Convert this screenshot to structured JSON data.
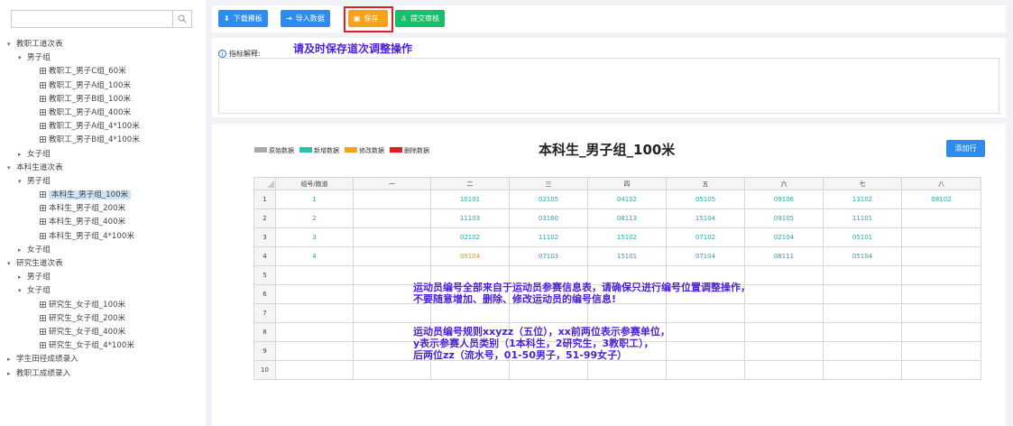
{
  "search": {
    "placeholder": "",
    "icon": "search-icon"
  },
  "tree": [
    {
      "label": "教职工道次表",
      "level": 0,
      "state": "open"
    },
    {
      "label": "男子组",
      "level": 1,
      "state": "open"
    },
    {
      "label": "教职工_男子C组_60米",
      "level": 2,
      "state": "leaf"
    },
    {
      "label": "教职工_男子A组_100米",
      "level": 2,
      "state": "leaf"
    },
    {
      "label": "教职工_男子B组_100米",
      "level": 2,
      "state": "leaf"
    },
    {
      "label": "教职工_男子A组_400米",
      "level": 2,
      "state": "leaf"
    },
    {
      "label": "教职工_男子A组_4*100米",
      "level": 2,
      "state": "leaf"
    },
    {
      "label": "教职工_男子B组_4*100米",
      "level": 2,
      "state": "leaf"
    },
    {
      "label": "女子组",
      "level": 1,
      "state": "closed"
    },
    {
      "label": "本科生道次表",
      "level": 0,
      "state": "open"
    },
    {
      "label": "男子组",
      "level": 1,
      "state": "open"
    },
    {
      "label": "本科生_男子组_100米",
      "level": 2,
      "state": "leaf",
      "selected": true
    },
    {
      "label": "本科生_男子组_200米",
      "level": 2,
      "state": "leaf"
    },
    {
      "label": "本科生_男子组_400米",
      "level": 2,
      "state": "leaf"
    },
    {
      "label": "本科生_男子组_4*100米",
      "level": 2,
      "state": "leaf"
    },
    {
      "label": "女子组",
      "level": 1,
      "state": "closed"
    },
    {
      "label": "研究生道次表",
      "level": 0,
      "state": "open"
    },
    {
      "label": "男子组",
      "level": 1,
      "state": "closed"
    },
    {
      "label": "女子组",
      "level": 1,
      "state": "open"
    },
    {
      "label": "研究生_女子组_100米",
      "level": 2,
      "state": "leaf"
    },
    {
      "label": "研究生_女子组_200米",
      "level": 2,
      "state": "leaf"
    },
    {
      "label": "研究生_女子组_400米",
      "level": 2,
      "state": "leaf"
    },
    {
      "label": "研究生_女子组_4*100米",
      "level": 2,
      "state": "leaf"
    },
    {
      "label": "学生田径成绩录入",
      "level": 0,
      "state": "closed"
    },
    {
      "label": "教职工成绩录入",
      "level": 0,
      "state": "closed"
    }
  ],
  "toolbar": {
    "download_label": "下载模板",
    "import_label": "导入数据",
    "save_label": "保存",
    "submit_label": "提交审核",
    "colors": {
      "download": "#2d8cf0",
      "import": "#2d8cf0",
      "save": "#f7a21b",
      "submit": "#19be6b"
    }
  },
  "annotations": {
    "save_hint": "请及时保存道次调整操作",
    "id_hint_1": "运动员编号全部来自于运动员参赛信息表，请确保只进行编号位置调整操作，",
    "id_hint_2": "不要随意增加、删除、修改运动员的编号信息!",
    "rule_1": "运动员编号规则xxyzz（五位），xx前两位表示参赛单位，",
    "rule_2": "y表示参赛人员类别（1本科生，2研究生，3教职工），",
    "rule_3": "后两位zz（流水号，01-50男子，51-99女子）"
  },
  "indicator": {
    "label": "指标解释:"
  },
  "legend": [
    {
      "label": "原始数据",
      "color": "#aaaaaa"
    },
    {
      "label": "新增数据",
      "color": "#2bbfb3"
    },
    {
      "label": "修改数据",
      "color": "#f7a21b"
    },
    {
      "label": "删除数据",
      "color": "#e02020"
    }
  ],
  "title": "本科生_男子组_100米",
  "add_row_label": "添加行",
  "table": {
    "headers": [
      "组号/跑道",
      "一",
      "二",
      "三",
      "四",
      "五",
      "六",
      "七",
      "八"
    ],
    "rows": [
      {
        "n": "1",
        "cells": [
          "1",
          "",
          "10101",
          "02105",
          "04102",
          "05105",
          "09106",
          "13102",
          "08102"
        ]
      },
      {
        "n": "2",
        "cells": [
          "2",
          "",
          "11103",
          "03160",
          "08113",
          "15104",
          "09105",
          "11101",
          ""
        ]
      },
      {
        "n": "3",
        "cells": [
          "3",
          "",
          "02102",
          "11102",
          "15102",
          "07102",
          "02104",
          "05101",
          ""
        ]
      },
      {
        "n": "4",
        "cells": [
          "4",
          "",
          "09104",
          "07103",
          "15101",
          "07104",
          "08111",
          "05104",
          ""
        ]
      },
      {
        "n": "5",
        "cells": [
          "",
          "",
          "",
          "",
          "",
          "",
          "",
          "",
          ""
        ]
      },
      {
        "n": "6",
        "cells": [
          "",
          "",
          "",
          "",
          "",
          "",
          "",
          "",
          ""
        ]
      },
      {
        "n": "7",
        "cells": [
          "",
          "",
          "",
          "",
          "",
          "",
          "",
          "",
          ""
        ]
      },
      {
        "n": "8",
        "cells": [
          "",
          "",
          "",
          "",
          "",
          "",
          "",
          "",
          ""
        ]
      },
      {
        "n": "9",
        "cells": [
          "",
          "",
          "",
          "",
          "",
          "",
          "",
          "",
          ""
        ]
      },
      {
        "n": "10",
        "cells": [
          "",
          "",
          "",
          "",
          "",
          "",
          "",
          "",
          ""
        ]
      }
    ],
    "modified_cell": {
      "row": 4,
      "col": 3
    }
  }
}
